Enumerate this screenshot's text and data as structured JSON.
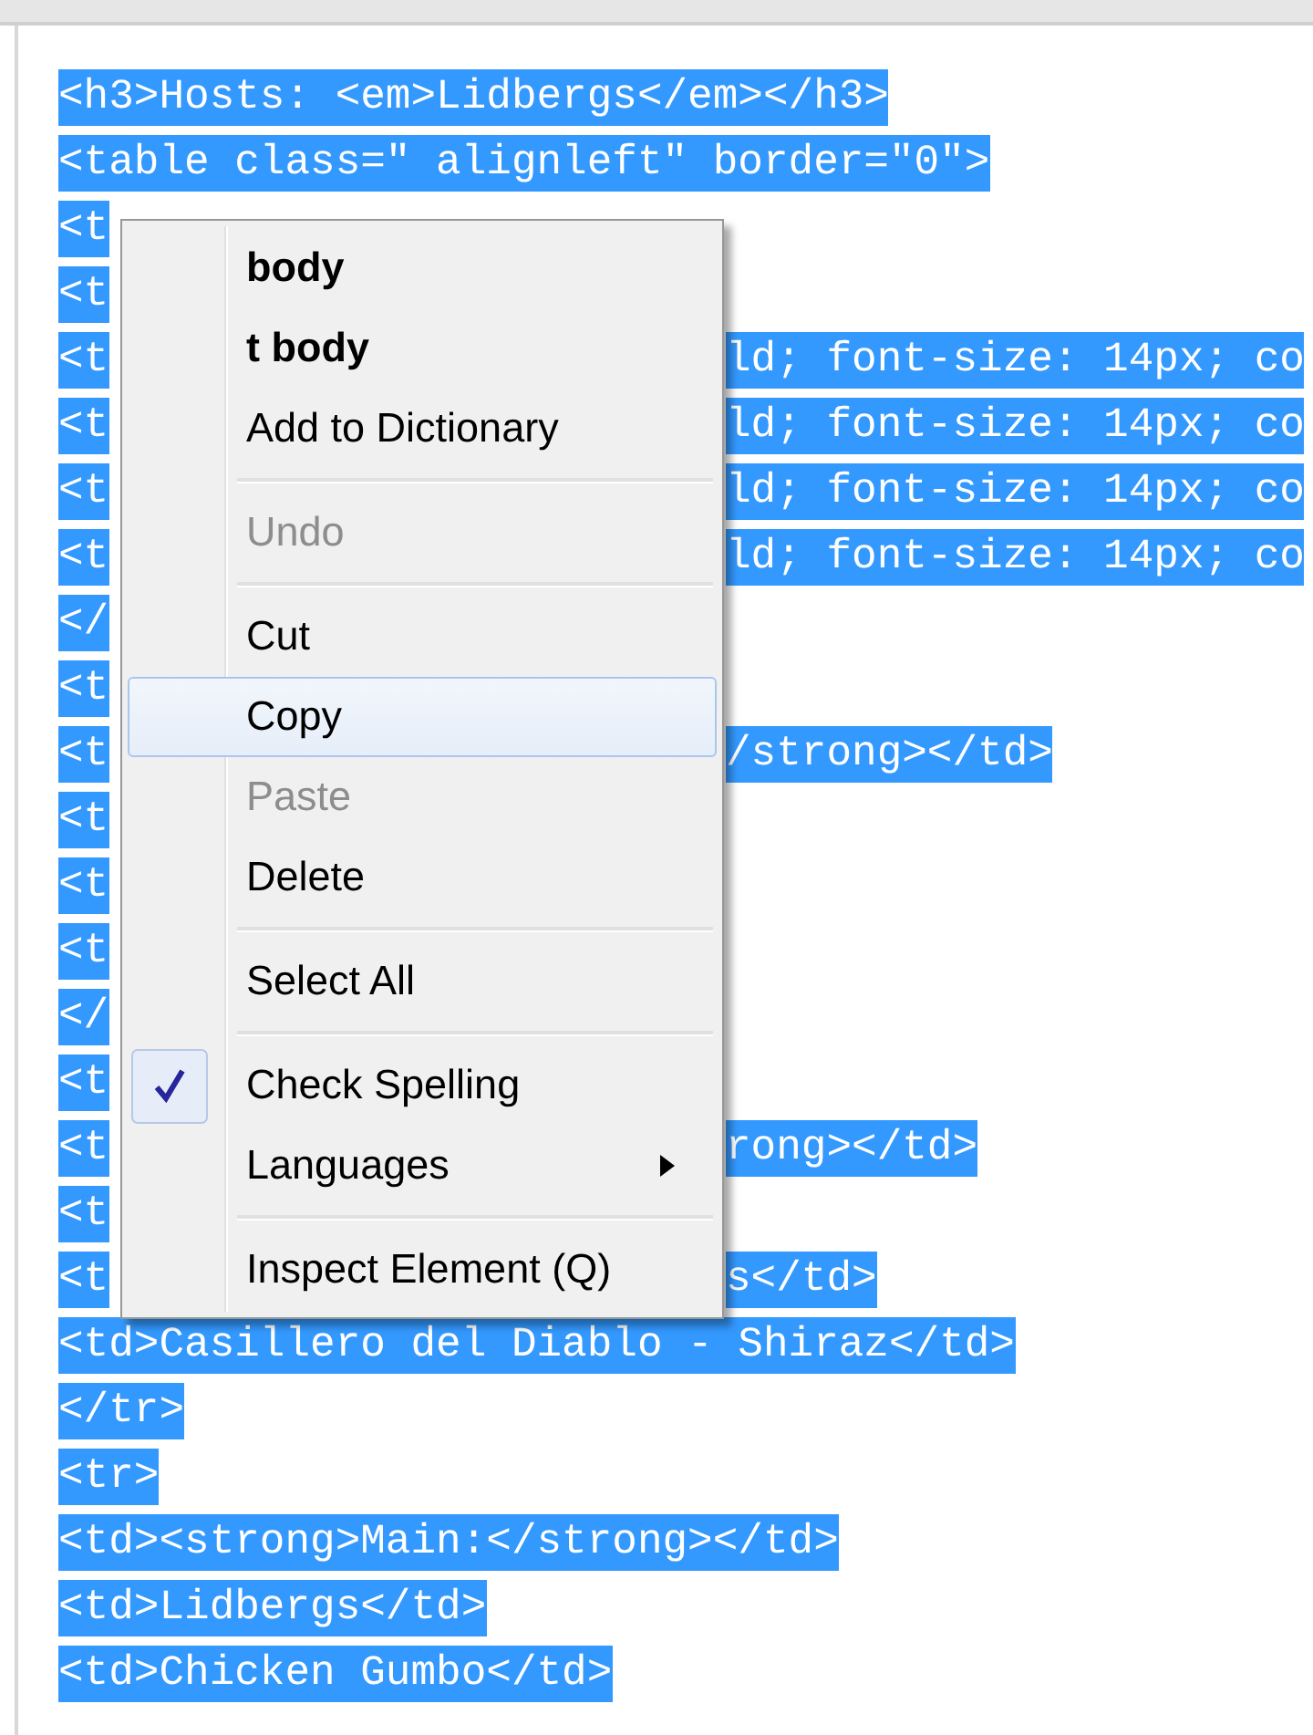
{
  "code_lines": [
    {
      "text": "<h3>Hosts: <em>Lidbergs</em></h3>"
    },
    {
      "text": "<table class=\" alignleft\" border=\"0\">"
    },
    {
      "text": "<t"
    },
    {
      "text": "<t"
    },
    {
      "text": "<t",
      "tail": "ld; font-size: 14px; co"
    },
    {
      "text": "<t",
      "tail": "ld; font-size: 14px; co"
    },
    {
      "text": "<t",
      "tail": "ld; font-size: 14px; co"
    },
    {
      "text": "<t",
      "tail": "ld; font-size: 14px; co"
    },
    {
      "text": "</"
    },
    {
      "text": "<t"
    },
    {
      "text": "<t",
      "tail": "/strong></td>"
    },
    {
      "text": "<t"
    },
    {
      "text": "<t"
    },
    {
      "text": "<t"
    },
    {
      "text": "</"
    },
    {
      "text": "<t"
    },
    {
      "text": "<t",
      "tail": "rong></td>"
    },
    {
      "text": "<t"
    },
    {
      "text": "<t",
      "tail": "s</td>"
    },
    {
      "text": "<td>Casillero del Diablo - Shiraz</td>"
    },
    {
      "text": "</tr>"
    },
    {
      "text": "<tr>"
    },
    {
      "text": "<td><strong>Main:</strong></td>"
    },
    {
      "text": "<td>Lidbergs</td>"
    },
    {
      "text": "<td>Chicken Gumbo</td>"
    }
  ],
  "context_menu": {
    "items": [
      {
        "kind": "suggestion",
        "label": "body",
        "disabled": false,
        "selected": false,
        "checked": false,
        "submenu": false
      },
      {
        "kind": "suggestion",
        "label": "t body",
        "disabled": false,
        "selected": false,
        "checked": false,
        "submenu": false
      },
      {
        "kind": "item",
        "label": "Add to Dictionary",
        "disabled": false,
        "selected": false,
        "checked": false,
        "submenu": false
      },
      {
        "kind": "separator"
      },
      {
        "kind": "item",
        "label": "Undo",
        "disabled": true,
        "selected": false,
        "checked": false,
        "submenu": false
      },
      {
        "kind": "separator"
      },
      {
        "kind": "item",
        "label": "Cut",
        "disabled": false,
        "selected": false,
        "checked": false,
        "submenu": false
      },
      {
        "kind": "item",
        "label": "Copy",
        "disabled": false,
        "selected": true,
        "checked": false,
        "submenu": false
      },
      {
        "kind": "item",
        "label": "Paste",
        "disabled": true,
        "selected": false,
        "checked": false,
        "submenu": false
      },
      {
        "kind": "item",
        "label": "Delete",
        "disabled": false,
        "selected": false,
        "checked": false,
        "submenu": false
      },
      {
        "kind": "separator"
      },
      {
        "kind": "item",
        "label": "Select All",
        "disabled": false,
        "selected": false,
        "checked": false,
        "submenu": false
      },
      {
        "kind": "separator"
      },
      {
        "kind": "item",
        "label": "Check Spelling",
        "disabled": false,
        "selected": false,
        "checked": true,
        "submenu": false
      },
      {
        "kind": "item",
        "label": "Languages",
        "disabled": false,
        "selected": false,
        "checked": false,
        "submenu": true
      },
      {
        "kind": "separator"
      },
      {
        "kind": "item",
        "label": "Inspect Element (Q)",
        "disabled": false,
        "selected": false,
        "checked": false,
        "submenu": false
      }
    ]
  }
}
